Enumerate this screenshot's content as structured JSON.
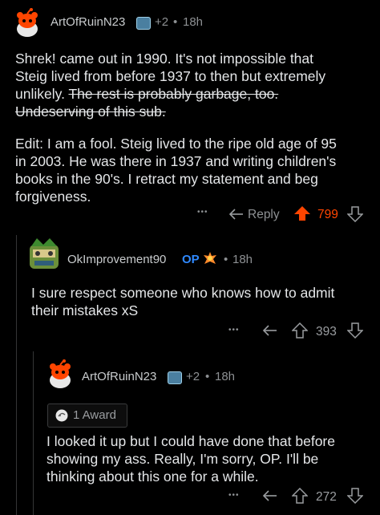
{
  "comments": [
    {
      "username": "ArtOfRuinN23",
      "badge_count": "+2",
      "time": "18h",
      "body_lines": [
        "Shrek! came out in 1990.  It's not impossible that",
        "Steig lived from before 1937 to then but extremely",
        "unlikely. "
      ],
      "struck_1": "The rest is probably garbage, too.",
      "struck_2": "Undeserving of this sub.",
      "edit_lines": [
        "Edit: I am a fool.  Steig lived to the ripe old age of 95",
        "in 2003.  He was there in 1937 and writing children's",
        "books in the 90's.  I retract my statement and beg",
        "forgiveness."
      ],
      "more": "•••",
      "reply_label": "Reply",
      "score": "799",
      "upvote_color": "#ff4500"
    },
    {
      "username": "OkImprovement90",
      "op_label": "OP",
      "time": "18h",
      "body_lines": [
        "I sure respect someone who knows how to admit",
        "their mistakes xS"
      ],
      "more": "•••",
      "score": "393"
    },
    {
      "username": "ArtOfRuinN23",
      "badge_count": "+2",
      "time": "18h",
      "award_label": "1 Award",
      "body_lines": [
        "I looked it up but I could have done that before",
        "showing my ass.  Really, I'm sorry, OP.  I'll be",
        "thinking about this one for a while."
      ],
      "more": "•••",
      "score": "272"
    }
  ],
  "separator": "•",
  "colors": {
    "background": "#000000",
    "text": "#e4e6e8",
    "meta": "#8d9093",
    "op": "#2f89ff",
    "upvote": "#ff4500",
    "snoo_red": "#ff4500"
  }
}
